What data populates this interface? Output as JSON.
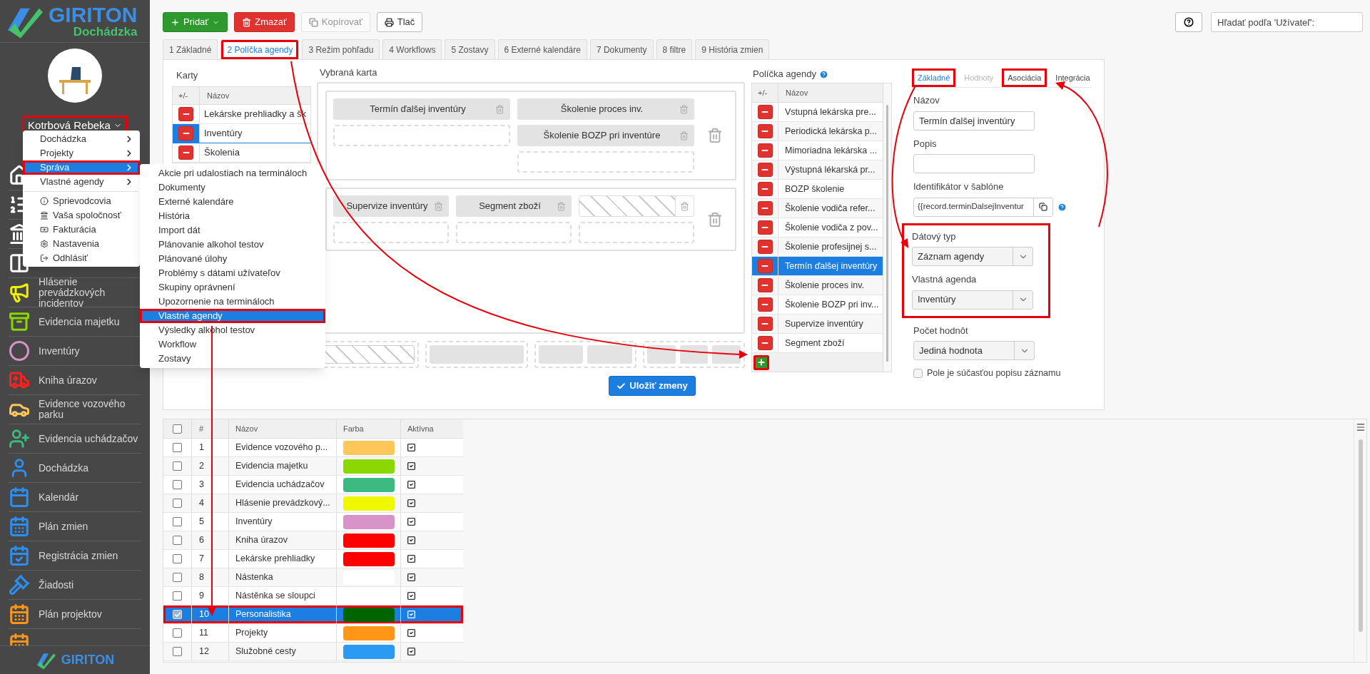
{
  "sidebar": {
    "logo": {
      "name": "GIRITON",
      "subtitle": "Dochádzka"
    },
    "user": {
      "name": "Kotrbová Rebeka",
      "highlighted": true
    },
    "items": [
      {
        "kind": "home"
      },
      {
        "kind": "list"
      },
      {
        "kind": "bank"
      },
      {
        "kind": "columns"
      },
      {
        "kind": "megaphone",
        "label": "Hlásenie prevádzkových incidentov"
      },
      {
        "kind": "box",
        "label": "Evidencia majetku"
      },
      {
        "kind": "ring",
        "label": "Inventúry"
      },
      {
        "kind": "ambulance",
        "label": "Kniha úrazov"
      },
      {
        "kind": "car",
        "label": "Evidence vozového parku"
      },
      {
        "kind": "user-plus",
        "label": "Evidencia uchádzačov"
      },
      {
        "kind": "user",
        "label": "Dochádzka"
      },
      {
        "kind": "calendar",
        "label": "Kalendár"
      },
      {
        "kind": "calendar-grid",
        "label": "Plán zmien"
      },
      {
        "kind": "calendar-check",
        "label": "Registrácia zmien"
      },
      {
        "kind": "gavel",
        "label": "Žiadosti"
      },
      {
        "kind": "calendar-orange",
        "label": "Plán projektov"
      },
      {
        "kind": "calendar-orange"
      }
    ],
    "footer_logo": "GIRITON"
  },
  "user_menu": [
    {
      "kind": "submenu",
      "label": "Dochádzka",
      "selected": false,
      "highlighted": false
    },
    {
      "kind": "submenu",
      "label": "Projekty",
      "selected": false,
      "highlighted": false
    },
    {
      "kind": "submenu",
      "label": "Správa",
      "selected": true,
      "highlighted": true
    },
    {
      "kind": "submenu",
      "label": "Vlastné agendy",
      "selected": false,
      "highlighted": false
    },
    {
      "kind": "info",
      "label": "Sprievodcovia",
      "selected": false,
      "highlighted": false
    },
    {
      "kind": "company",
      "label": "Vaša spoločnosť",
      "selected": false,
      "highlighted": false
    },
    {
      "kind": "billing",
      "label": "Fakturácia",
      "selected": false,
      "highlighted": false
    },
    {
      "kind": "settings",
      "label": "Nastavenia",
      "selected": false,
      "highlighted": false
    },
    {
      "kind": "logout",
      "label": "Odhlásiť",
      "selected": false,
      "highlighted": false
    }
  ],
  "submenu": [
    {
      "label": "Akcie pri udalostiach na termináloch",
      "selected": false,
      "highlighted": false
    },
    {
      "label": "Dokumenty",
      "selected": false,
      "highlighted": false
    },
    {
      "label": "Externé kalendáre",
      "selected": false,
      "highlighted": false
    },
    {
      "label": "História",
      "selected": false,
      "highlighted": false
    },
    {
      "label": "Import dát",
      "selected": false,
      "highlighted": false
    },
    {
      "label": "Plánovanie alkohol testov",
      "selected": false,
      "highlighted": false
    },
    {
      "label": "Plánované úlohy",
      "selected": false,
      "highlighted": false
    },
    {
      "label": "Problémy s dátami užívateľov",
      "selected": false,
      "highlighted": false
    },
    {
      "label": "Skupiny oprávnení",
      "selected": false,
      "highlighted": false
    },
    {
      "label": "Upozornenie na termináloch",
      "selected": false,
      "highlighted": false
    },
    {
      "label": "Vlastné agendy",
      "selected": true,
      "highlighted": true
    },
    {
      "label": "Výsledky alkohol testov",
      "selected": false,
      "highlighted": false
    },
    {
      "label": "Workflow",
      "selected": false,
      "highlighted": false
    },
    {
      "label": "Zostavy",
      "selected": false,
      "highlighted": false
    }
  ],
  "toolbar": {
    "buttons": [
      {
        "kind": "add",
        "label": "Pridať",
        "disabled": false
      },
      {
        "kind": "delete",
        "label": "Zmazať",
        "disabled": false
      },
      {
        "kind": "copy",
        "label": "Kopírovať",
        "disabled": true
      },
      {
        "kind": "print",
        "label": "Tlač",
        "disabled": false
      }
    ],
    "search": {
      "placeholder": "Hľadať podľa 'Užívateľ':"
    }
  },
  "tabs": [
    {
      "label": "1 Základné",
      "selected": false,
      "highlighted": false
    },
    {
      "label": "2 Políčka agendy",
      "selected": true,
      "highlighted": true
    },
    {
      "label": "3 Režim pohľadu",
      "selected": false,
      "highlighted": false
    },
    {
      "label": "4 Workflows",
      "selected": false,
      "highlighted": false
    },
    {
      "label": "5 Zostavy",
      "selected": false,
      "highlighted": false
    },
    {
      "label": "6 Externé kalendáre",
      "selected": false,
      "highlighted": false
    },
    {
      "label": "7 Dokumenty",
      "selected": false,
      "highlighted": false
    },
    {
      "label": "8 filtre",
      "selected": false,
      "highlighted": false
    },
    {
      "label": "9 História zmien",
      "selected": false,
      "highlighted": false
    }
  ],
  "cards": {
    "title": "Karty",
    "columns": [
      "+/-",
      "Názov"
    ],
    "rows": [
      {
        "name": "Lekárske prehliadky a šk",
        "selected": false
      },
      {
        "name": "Inventúry",
        "selected": true
      },
      {
        "name": "Školenia",
        "selected": false
      }
    ]
  },
  "selected_card": {
    "title": "Vybraná karta",
    "sections": [
      {
        "columns": [
          [
            {
              "kind": "field",
              "label": "Termín ďalšej inventúry"
            },
            {
              "kind": "empty"
            }
          ],
          [
            {
              "kind": "field",
              "label": "Školenie proces inv."
            },
            {
              "kind": "field",
              "label": "Školenie BOZP pri inventúre"
            },
            {
              "kind": "empty"
            }
          ]
        ]
      },
      {
        "columns": [
          [
            {
              "kind": "field",
              "label": "Supervize inventúry"
            },
            {
              "kind": "empty"
            }
          ],
          [
            {
              "kind": "field",
              "label": "Segment zboží"
            },
            {
              "kind": "empty"
            }
          ],
          [
            {
              "kind": "hatched"
            },
            {
              "kind": "empty"
            }
          ]
        ]
      }
    ],
    "palette": [
      {
        "slots": [
          {
            "kind": "hatched"
          }
        ]
      },
      {
        "slots": [
          {
            "kind": "solid"
          }
        ]
      },
      {
        "slots": [
          {
            "kind": "solid"
          },
          {
            "kind": "solid"
          }
        ]
      },
      {
        "slots": [
          {
            "kind": "solid"
          },
          {
            "kind": "solid"
          },
          {
            "kind": "solid"
          }
        ]
      }
    ],
    "save_button": "Uložiť zmeny"
  },
  "fields": {
    "title": "Políčka agendy",
    "columns": [
      "+/-",
      "Názov"
    ],
    "rows": [
      {
        "name": "Vstupná lekárska pre...",
        "selected": false
      },
      {
        "name": "Periodická lekárska p...",
        "selected": false
      },
      {
        "name": "Mimoriadna lekárska ...",
        "selected": false
      },
      {
        "name": "Výstupná lékarská pr...",
        "selected": false
      },
      {
        "name": "BOZP školenie",
        "selected": false
      },
      {
        "name": "Školenie vodiča refer...",
        "selected": false
      },
      {
        "name": "Školenie vodiča z pov...",
        "selected": false
      },
      {
        "name": "Školenie profesijnej s...",
        "selected": false
      },
      {
        "name": "Termín ďalšej inventúry",
        "selected": true
      },
      {
        "name": "Školenie proces inv.",
        "selected": false
      },
      {
        "name": "Školenie BOZP pri inv...",
        "selected": false
      },
      {
        "name": "Supervize inventúry",
        "selected": false
      },
      {
        "name": "Segment zboží",
        "selected": false
      }
    ],
    "add_highlighted": true
  },
  "field_form": {
    "tabs": [
      {
        "label": "Základné",
        "selected": true,
        "disabled": false,
        "highlighted": true
      },
      {
        "label": "Hodnoty",
        "selected": false,
        "disabled": true,
        "highlighted": false
      },
      {
        "label": "Asociácia",
        "selected": false,
        "disabled": false,
        "highlighted": true
      },
      {
        "label": "Integrácia",
        "selected": false,
        "disabled": false,
        "highlighted": false
      }
    ],
    "fields": [
      {
        "kind": "text",
        "label": "Názov",
        "value": "Termín ďalšej inventúry",
        "highlighted": false
      },
      {
        "kind": "text",
        "label": "Popis",
        "highlighted": false
      },
      {
        "kind": "copy",
        "label": "Identifikátor v šablóne",
        "value": "{{record.terminDalsejInventur",
        "highlighted": false
      },
      {
        "kind": "select",
        "label": "Dátový typ",
        "value": "Záznam agendy",
        "highlighted": true
      },
      {
        "kind": "select",
        "label": "Vlastná agenda",
        "value": "Inventúry",
        "highlighted": true
      },
      {
        "kind": "select",
        "label": "Počet hodnôt",
        "value": "Jediná hodnota",
        "highlighted": false
      },
      {
        "kind": "checkbox",
        "label": "Pole je súčasťou popisu záznamu",
        "checked": false,
        "highlighted": false
      }
    ]
  },
  "agenda_table": {
    "columns": [
      "#",
      "Názov",
      "Farba",
      "Aktívna"
    ],
    "all_checked": false,
    "rows": [
      {
        "number": "1",
        "name": "Evidence vozového p...",
        "color": "#ffc65a",
        "checked": false,
        "selected": false,
        "active": true
      },
      {
        "number": "2",
        "name": "Evidencia majetku",
        "color": "#8bd800",
        "checked": false,
        "selected": false,
        "active": true
      },
      {
        "number": "3",
        "name": "Evidencia uchádzačov",
        "color": "#3dba82",
        "checked": false,
        "selected": false,
        "active": true
      },
      {
        "number": "4",
        "name": "Hlásenie prevádzkový...",
        "color": "#f0f800",
        "checked": false,
        "selected": false,
        "active": true
      },
      {
        "number": "5",
        "name": "Inventúry",
        "color": "#d894c8",
        "checked": false,
        "selected": false,
        "active": true
      },
      {
        "number": "6",
        "name": "Kniha úrazov",
        "color": "#ff0000",
        "checked": false,
        "selected": false,
        "active": true
      },
      {
        "number": "7",
        "name": "Lekárske prehliadky",
        "color": "#ff0000",
        "checked": false,
        "selected": false,
        "active": true
      },
      {
        "number": "8",
        "name": "Nástenka",
        "color": "#ffffff",
        "checked": false,
        "selected": false,
        "active": true
      },
      {
        "number": "9",
        "name": "Nástěnka se sloupci",
        "checked": false,
        "selected": false,
        "active": true
      },
      {
        "number": "10",
        "name": "Personalistika",
        "color": "#006400",
        "checked": true,
        "selected": true,
        "active": true,
        "highlighted": true
      },
      {
        "number": "11",
        "name": "Projekty",
        "color": "#ff9618",
        "checked": false,
        "selected": false,
        "active": true
      },
      {
        "number": "12",
        "name": "Služobné cesty",
        "color": "#2b9af3",
        "checked": false,
        "selected": false,
        "active": true
      }
    ]
  }
}
